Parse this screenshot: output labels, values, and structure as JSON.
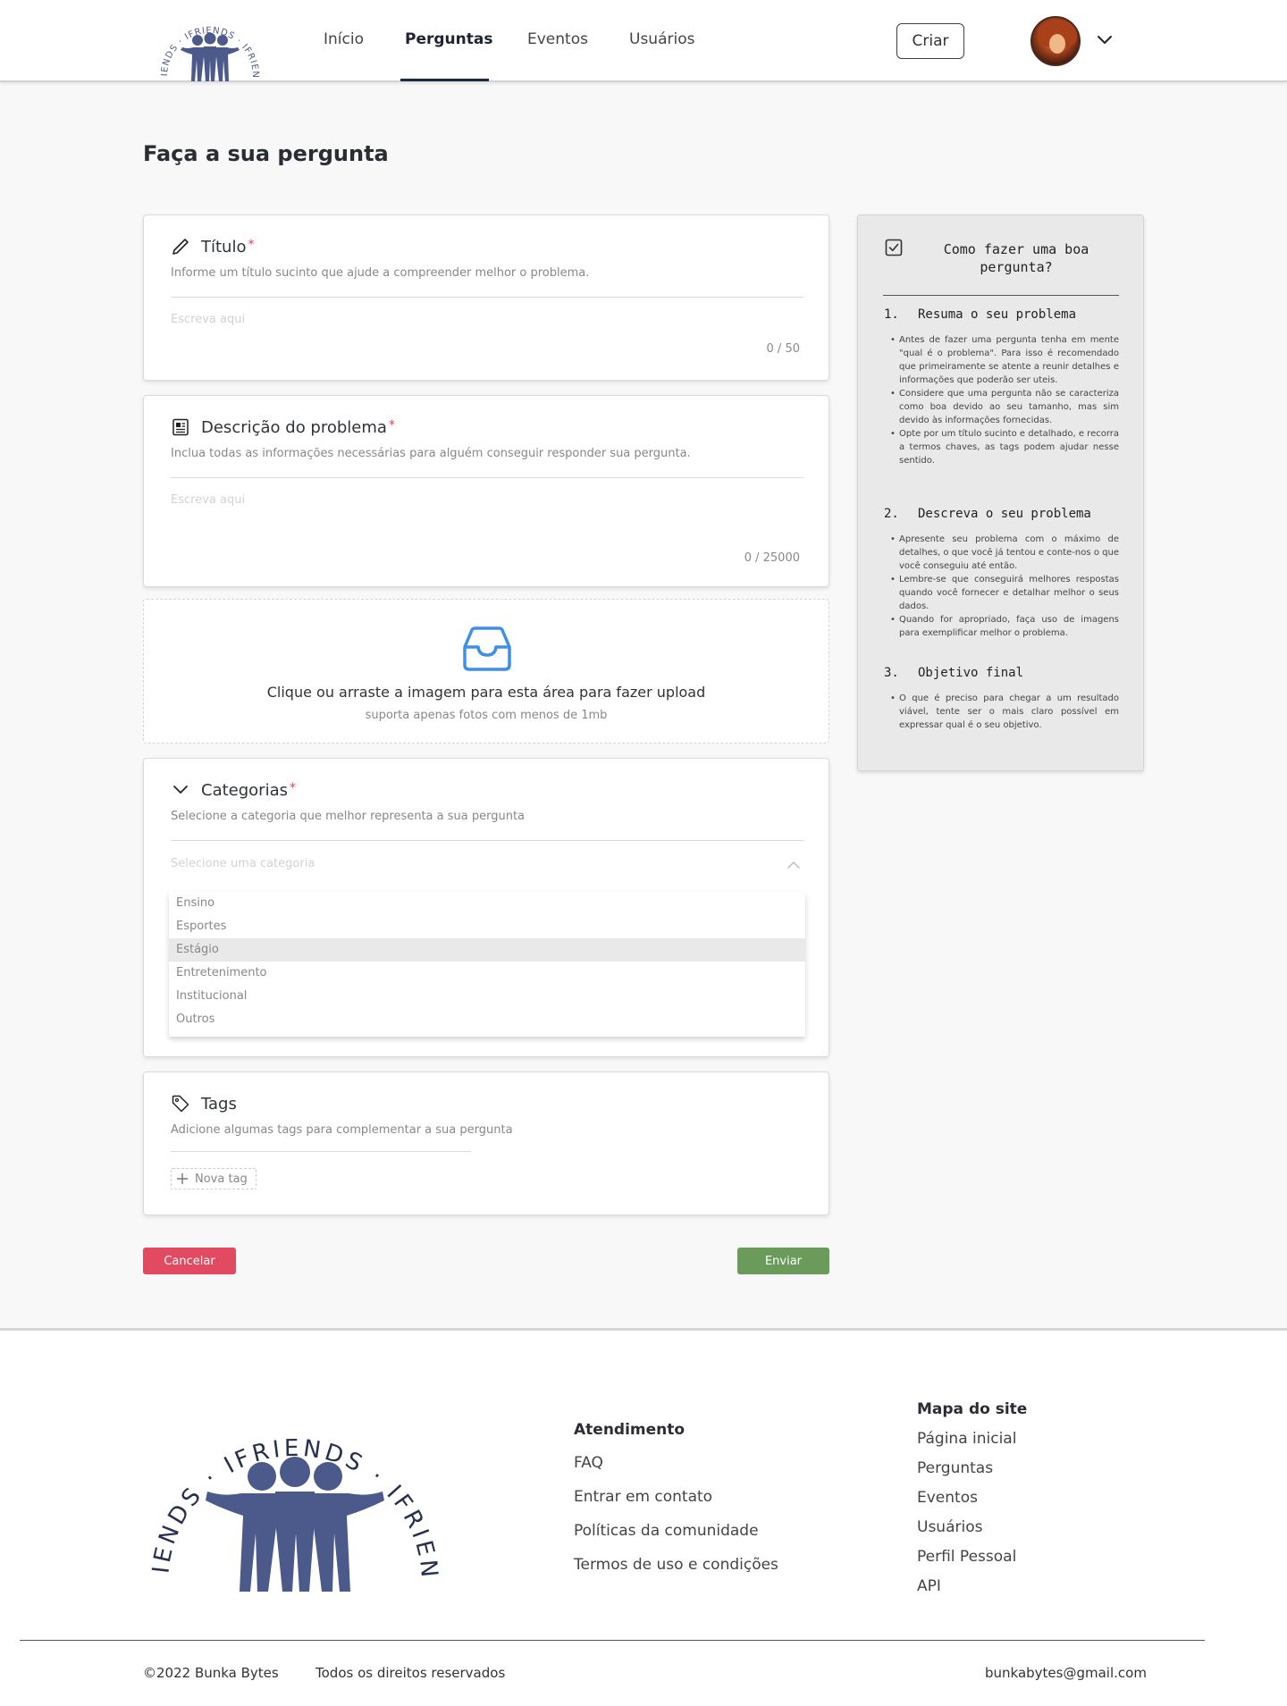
{
  "header": {
    "logo_text": "IFRIENDS",
    "nav": [
      "Início",
      "Perguntas",
      "Eventos",
      "Usuários"
    ],
    "active_nav": "Perguntas",
    "create_label": "Criar"
  },
  "page": {
    "title": "Faça a sua pergunta"
  },
  "titulo": {
    "label": "Título",
    "required_mark": "*",
    "description": "Informe um título sucinto que ajude a compreender melhor o problema.",
    "placeholder": "Escreva aqui",
    "counter": "0 / 50"
  },
  "descricao": {
    "label": "Descrição do problema",
    "required_mark": "*",
    "description": "Inclua todas as informações necessárias para alguém conseguir responder sua pergunta.",
    "placeholder": "Escreva aqui",
    "counter": "0 / 25000"
  },
  "upload": {
    "main_text": "Clique ou arraste a imagem para esta área para fazer upload",
    "sub_text": "suporta apenas fotos com menos de 1mb"
  },
  "categorias": {
    "label": "Categorias",
    "required_mark": "*",
    "description": "Selecione a categoria que melhor representa a sua pergunta",
    "placeholder": "Selecione uma categoria",
    "options": [
      "Ensino",
      "Esportes",
      "Estágio",
      "Entretenimento",
      "Institucional",
      "Outros"
    ],
    "highlighted": "Estágio"
  },
  "tags": {
    "label": "Tags",
    "description": "Adicione algumas tags para complementar a sua pergunta",
    "new_tag_label": "Nova tag"
  },
  "actions": {
    "cancel_label": "Cancelar",
    "send_label": "Enviar"
  },
  "tips": {
    "title": "Como fazer uma boa pergunta?",
    "sections": [
      {
        "number": "1.",
        "heading": "Resuma o seu problema",
        "items": [
          "Antes de fazer uma pergunta tenha em mente \"qual é o problema\". Para isso é recomendado que primeiramente se atente a reunir detalhes e informações que poderão ser uteis.",
          "Considere que uma pergunta não se caracteriza como boa devido ao seu tamanho, mas sim devido às informações fornecidas.",
          "Opte por um título sucinto e detalhado, e recorra a termos chaves, as tags podem ajudar nesse sentido."
        ]
      },
      {
        "number": "2.",
        "heading": "Descreva o seu problema",
        "items": [
          "Apresente seu problema com o máximo de detalhes, o que você já tentou e conte-nos o que você conseguiu até então.",
          "Lembre-se que conseguirá melhores respostas quando você fornecer e detalhar melhor o seus dados.",
          "Quando for apropriado, faça uso de imagens para exemplificar melhor o problema."
        ]
      },
      {
        "number": "3.",
        "heading": "Objetivo final",
        "items": [
          "O que é preciso para chegar a um resultado viável, tente ser o mais claro possível em expressar qual é o seu objetivo."
        ]
      }
    ]
  },
  "footer": {
    "logo_text": "IFRIENDS",
    "atendimento_title": "Atendimento",
    "atendimento_links": [
      "FAQ",
      "Entrar em contato",
      "Políticas da comunidade",
      "Termos de uso e condições"
    ],
    "mapa_title": "Mapa do site",
    "mapa_links": [
      "Página inicial",
      "Perguntas",
      "Eventos",
      "Usuários",
      "Perfil Pessoal",
      "API"
    ],
    "copyright": "©2022 Bunka Bytes",
    "rights": "Todos os direitos reservados",
    "email": "bunkabytes@gmail.com"
  },
  "colors": {
    "brand_navy": "#4b5a8a",
    "cancel_red": "#e24a61",
    "send_green": "#6a9b5a",
    "upload_blue": "#3f8fe8",
    "required_red": "#e0434e"
  }
}
